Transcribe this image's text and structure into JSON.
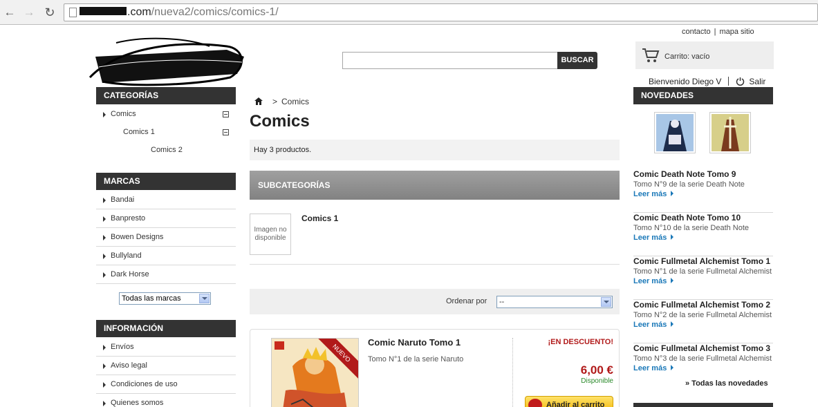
{
  "browser": {
    "url_host_suffix": ".com",
    "url_path": "/nueva2/comics/comics-1/"
  },
  "top_links": {
    "contact": "contacto",
    "sitemap": "mapa sitio"
  },
  "search": {
    "button_label": "BUSCAR",
    "value": ""
  },
  "cart": {
    "label": "Carrito: vacío"
  },
  "user": {
    "welcome": "Bienvenido Diego V",
    "logout": "Salir"
  },
  "left": {
    "categories_title": "CATEGORÍAS",
    "categories": [
      {
        "label": "Comics"
      },
      {
        "label": "Comics 1"
      },
      {
        "label": "Comics 2"
      }
    ],
    "brands_title": "MARCAS",
    "brands": [
      "Bandai",
      "Banpresto",
      "Bowen Designs",
      "Bullyland",
      "Dark Horse"
    ],
    "brand_select_value": "Todas las marcas",
    "info_title": "INFORMACIÓN",
    "info_links": [
      "Envíos",
      "Aviso legal",
      "Condiciones de uso",
      "Quienes somos"
    ]
  },
  "main": {
    "breadcrumb_sep": ">",
    "breadcrumb_current": "Comics",
    "title": "Comics",
    "product_count": "Hay 3 productos.",
    "subcategories_title": "SUBCATEGORÍAS",
    "subcategory": {
      "image_text": "Imagen no disponible",
      "name": "Comics 1"
    },
    "sort": {
      "label": "Ordenar por",
      "value": "--"
    },
    "product": {
      "badge": "NUEVO",
      "name": "Comic Naruto Tomo 1",
      "description": "Tomo N°1 de la serie Naruto",
      "discount": "¡EN DESCUENTO!",
      "price": "6,00 €",
      "availability": "Disponible",
      "add_to_cart": "Añadir al carrito"
    }
  },
  "right": {
    "novedades_title": "NOVEDADES",
    "more_label": "Leer más",
    "items": [
      {
        "title": "Comic Death Note Tomo 9",
        "desc": "Tomo N°9 de la serie Death Note"
      },
      {
        "title": "Comic Death Note Tomo 10",
        "desc": "Tomo N°10 de la serie Death Note"
      },
      {
        "title": "Comic Fullmetal Alchemist Tomo 1",
        "desc": "Tomo N°1 de la serie Fullmetal Alchemist"
      },
      {
        "title": "Comic Fullmetal Alchemist Tomo 2",
        "desc": "Tomo N°2 de la serie Fullmetal Alchemist"
      },
      {
        "title": "Comic Fullmetal Alchemist Tomo 3",
        "desc": "Tomo N°3 de la serie Fullmetal Alchemist"
      }
    ],
    "all_label": "» Todas las novedades"
  },
  "colors": {
    "accent_red": "#b11a1a",
    "link_blue": "#1a78b8",
    "block_dark": "#333333"
  }
}
